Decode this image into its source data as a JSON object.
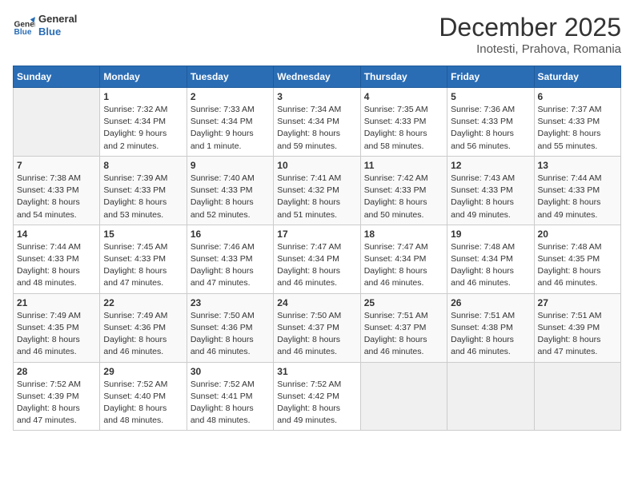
{
  "logo": {
    "line1": "General",
    "line2": "Blue"
  },
  "title": "December 2025",
  "subtitle": "Inotesti, Prahova, Romania",
  "days_of_week": [
    "Sunday",
    "Monday",
    "Tuesday",
    "Wednesday",
    "Thursday",
    "Friday",
    "Saturday"
  ],
  "weeks": [
    [
      {
        "num": "",
        "info": ""
      },
      {
        "num": "1",
        "info": "Sunrise: 7:32 AM\nSunset: 4:34 PM\nDaylight: 9 hours\nand 2 minutes."
      },
      {
        "num": "2",
        "info": "Sunrise: 7:33 AM\nSunset: 4:34 PM\nDaylight: 9 hours\nand 1 minute."
      },
      {
        "num": "3",
        "info": "Sunrise: 7:34 AM\nSunset: 4:34 PM\nDaylight: 8 hours\nand 59 minutes."
      },
      {
        "num": "4",
        "info": "Sunrise: 7:35 AM\nSunset: 4:33 PM\nDaylight: 8 hours\nand 58 minutes."
      },
      {
        "num": "5",
        "info": "Sunrise: 7:36 AM\nSunset: 4:33 PM\nDaylight: 8 hours\nand 56 minutes."
      },
      {
        "num": "6",
        "info": "Sunrise: 7:37 AM\nSunset: 4:33 PM\nDaylight: 8 hours\nand 55 minutes."
      }
    ],
    [
      {
        "num": "7",
        "info": "Sunrise: 7:38 AM\nSunset: 4:33 PM\nDaylight: 8 hours\nand 54 minutes."
      },
      {
        "num": "8",
        "info": "Sunrise: 7:39 AM\nSunset: 4:33 PM\nDaylight: 8 hours\nand 53 minutes."
      },
      {
        "num": "9",
        "info": "Sunrise: 7:40 AM\nSunset: 4:33 PM\nDaylight: 8 hours\nand 52 minutes."
      },
      {
        "num": "10",
        "info": "Sunrise: 7:41 AM\nSunset: 4:32 PM\nDaylight: 8 hours\nand 51 minutes."
      },
      {
        "num": "11",
        "info": "Sunrise: 7:42 AM\nSunset: 4:33 PM\nDaylight: 8 hours\nand 50 minutes."
      },
      {
        "num": "12",
        "info": "Sunrise: 7:43 AM\nSunset: 4:33 PM\nDaylight: 8 hours\nand 49 minutes."
      },
      {
        "num": "13",
        "info": "Sunrise: 7:44 AM\nSunset: 4:33 PM\nDaylight: 8 hours\nand 49 minutes."
      }
    ],
    [
      {
        "num": "14",
        "info": "Sunrise: 7:44 AM\nSunset: 4:33 PM\nDaylight: 8 hours\nand 48 minutes."
      },
      {
        "num": "15",
        "info": "Sunrise: 7:45 AM\nSunset: 4:33 PM\nDaylight: 8 hours\nand 47 minutes."
      },
      {
        "num": "16",
        "info": "Sunrise: 7:46 AM\nSunset: 4:33 PM\nDaylight: 8 hours\nand 47 minutes."
      },
      {
        "num": "17",
        "info": "Sunrise: 7:47 AM\nSunset: 4:34 PM\nDaylight: 8 hours\nand 46 minutes."
      },
      {
        "num": "18",
        "info": "Sunrise: 7:47 AM\nSunset: 4:34 PM\nDaylight: 8 hours\nand 46 minutes."
      },
      {
        "num": "19",
        "info": "Sunrise: 7:48 AM\nSunset: 4:34 PM\nDaylight: 8 hours\nand 46 minutes."
      },
      {
        "num": "20",
        "info": "Sunrise: 7:48 AM\nSunset: 4:35 PM\nDaylight: 8 hours\nand 46 minutes."
      }
    ],
    [
      {
        "num": "21",
        "info": "Sunrise: 7:49 AM\nSunset: 4:35 PM\nDaylight: 8 hours\nand 46 minutes."
      },
      {
        "num": "22",
        "info": "Sunrise: 7:49 AM\nSunset: 4:36 PM\nDaylight: 8 hours\nand 46 minutes."
      },
      {
        "num": "23",
        "info": "Sunrise: 7:50 AM\nSunset: 4:36 PM\nDaylight: 8 hours\nand 46 minutes."
      },
      {
        "num": "24",
        "info": "Sunrise: 7:50 AM\nSunset: 4:37 PM\nDaylight: 8 hours\nand 46 minutes."
      },
      {
        "num": "25",
        "info": "Sunrise: 7:51 AM\nSunset: 4:37 PM\nDaylight: 8 hours\nand 46 minutes."
      },
      {
        "num": "26",
        "info": "Sunrise: 7:51 AM\nSunset: 4:38 PM\nDaylight: 8 hours\nand 46 minutes."
      },
      {
        "num": "27",
        "info": "Sunrise: 7:51 AM\nSunset: 4:39 PM\nDaylight: 8 hours\nand 47 minutes."
      }
    ],
    [
      {
        "num": "28",
        "info": "Sunrise: 7:52 AM\nSunset: 4:39 PM\nDaylight: 8 hours\nand 47 minutes."
      },
      {
        "num": "29",
        "info": "Sunrise: 7:52 AM\nSunset: 4:40 PM\nDaylight: 8 hours\nand 48 minutes."
      },
      {
        "num": "30",
        "info": "Sunrise: 7:52 AM\nSunset: 4:41 PM\nDaylight: 8 hours\nand 48 minutes."
      },
      {
        "num": "31",
        "info": "Sunrise: 7:52 AM\nSunset: 4:42 PM\nDaylight: 8 hours\nand 49 minutes."
      },
      {
        "num": "",
        "info": ""
      },
      {
        "num": "",
        "info": ""
      },
      {
        "num": "",
        "info": ""
      }
    ]
  ]
}
